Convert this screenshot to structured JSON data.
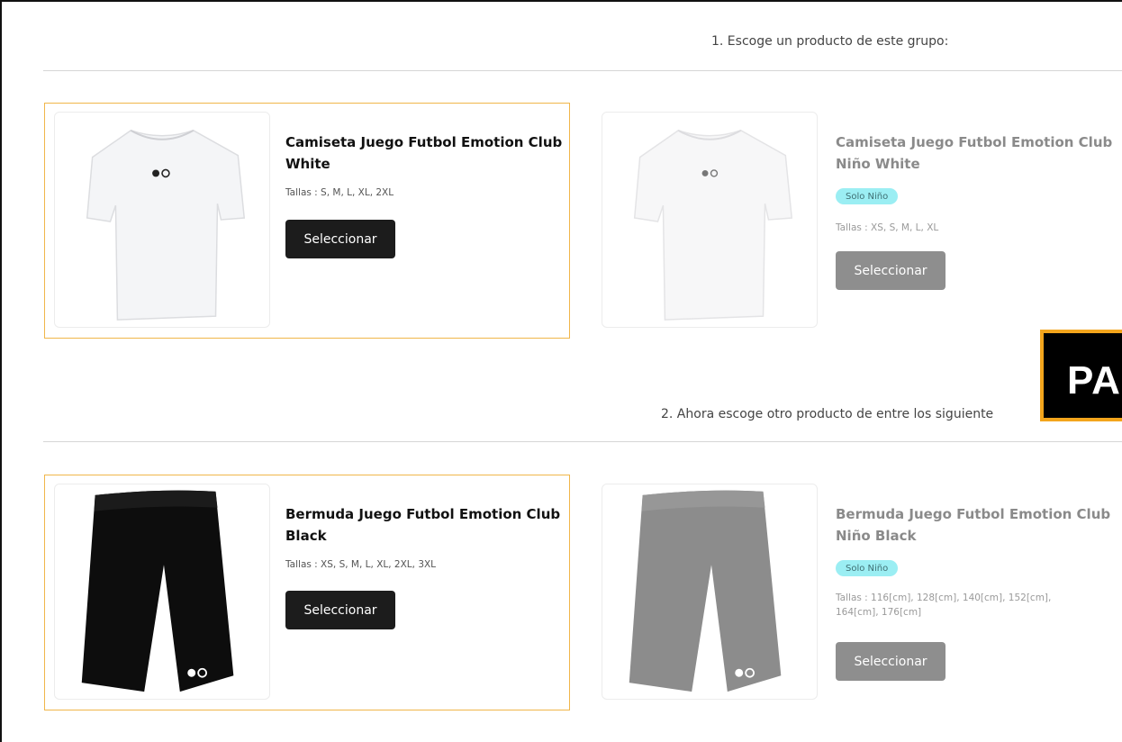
{
  "section1": {
    "heading": "1. Escoge un producto de este grupo:",
    "products": [
      {
        "title_line1": "Camiseta Juego Futbol Emotion Club",
        "title_line2": "White",
        "sizes": "Tallas : S, M, L, XL, 2XL",
        "button": "Seleccionar",
        "selected": true,
        "image": "white-tshirt"
      },
      {
        "title_line1": "Camiseta Juego Futbol Emotion Club",
        "title_line2": "Niño White",
        "badge": "Solo Niño",
        "sizes": "Tallas : XS, S, M, L, XL",
        "button": "Seleccionar",
        "selected": false,
        "image": "white-tshirt"
      }
    ]
  },
  "section2": {
    "heading": "2. Ahora escoge otro producto de entre los siguiente",
    "products": [
      {
        "title_line1": "Bermuda Juego Futbol Emotion Club",
        "title_line2": "Black",
        "sizes": "Tallas : XS, S, M, L, XL, 2XL, 3XL",
        "button": "Seleccionar",
        "selected": true,
        "image": "black-shorts"
      },
      {
        "title_line1": "Bermuda Juego Futbol Emotion Club",
        "title_line2": "Niño Black",
        "badge": "Solo Niño",
        "sizes_line1": "Tallas : 116[cm], 128[cm], 140[cm], 152[cm],",
        "sizes_line2": "164[cm], 176[cm]",
        "button": "Seleccionar",
        "selected": false,
        "image": "grey-shorts"
      }
    ]
  },
  "overlay": {
    "text": "PA"
  },
  "colors": {
    "selected_border": "#f0b64a",
    "button_dark": "#1c1c1c",
    "button_grey": "#8e8e8e",
    "badge_bg": "#9beef3",
    "overlay_border": "#f3a51c"
  }
}
